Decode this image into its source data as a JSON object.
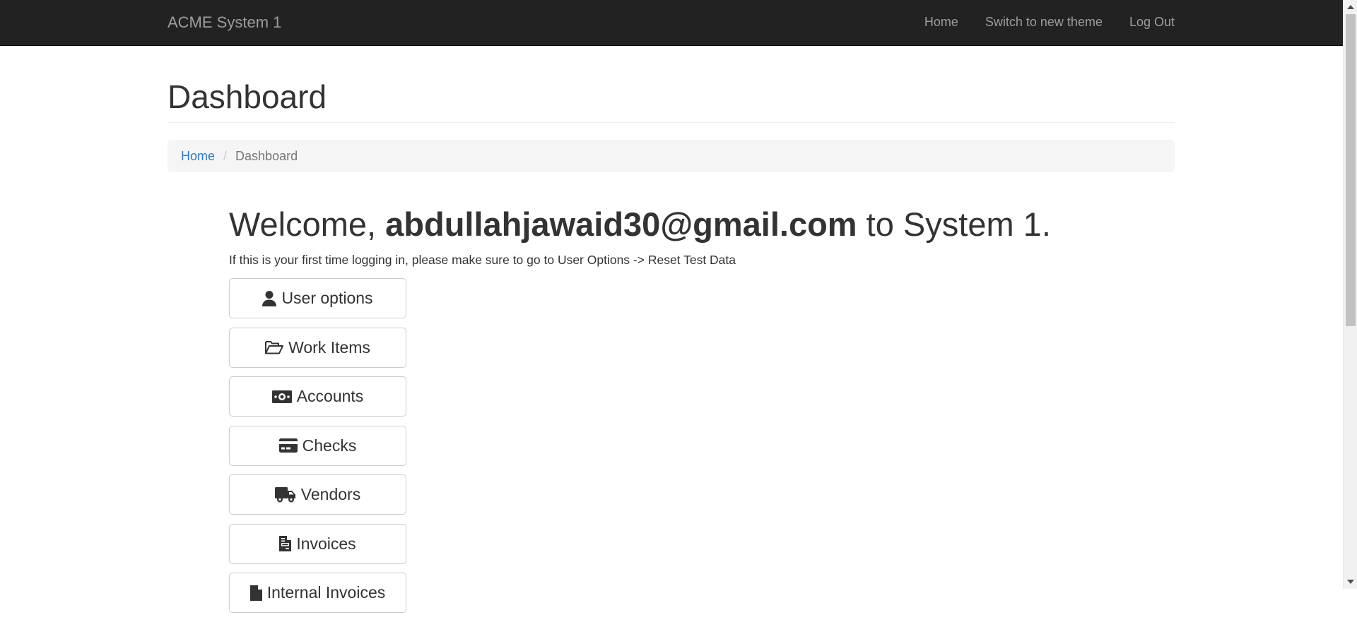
{
  "navbar": {
    "brand": "ACME System 1",
    "links": [
      "Home",
      "Switch to new theme",
      "Log Out"
    ]
  },
  "page": {
    "title": "Dashboard"
  },
  "breadcrumb": {
    "home": "Home",
    "current": "Dashboard"
  },
  "welcome": {
    "prefix": "Welcome, ",
    "user": "abdullahjawaid30@gmail.com",
    "suffix": " to System 1."
  },
  "note": "If this is your first time logging in, please make sure to go to User Options -> Reset Test Data",
  "buttons": [
    {
      "label": "User options",
      "icon": "user-icon"
    },
    {
      "label": "Work Items",
      "icon": "folder-open-icon"
    },
    {
      "label": "Accounts",
      "icon": "money-bill-icon"
    },
    {
      "label": "Checks",
      "icon": "credit-card-icon"
    },
    {
      "label": "Vendors",
      "icon": "truck-icon"
    },
    {
      "label": "Invoices",
      "icon": "file-invoice-icon"
    },
    {
      "label": "Internal Invoices",
      "icon": "file-icon"
    }
  ]
}
